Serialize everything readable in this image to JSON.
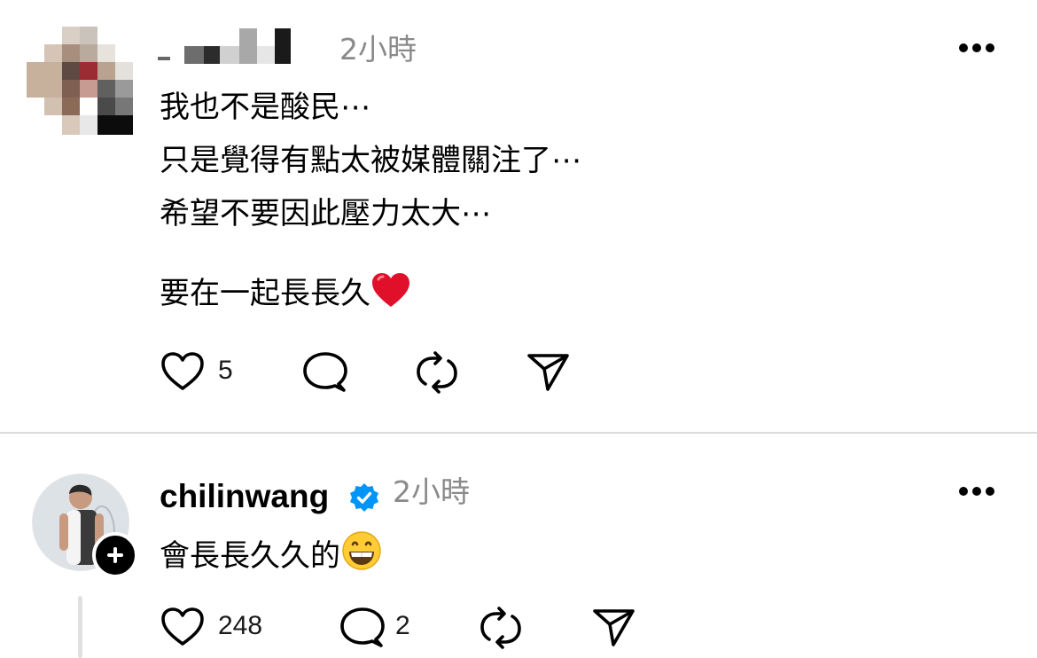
{
  "posts": [
    {
      "time": "2小時",
      "lines": [
        "我也不是酸民⋯",
        "只是覺得有點太被媒體關注了⋯",
        "希望不要因此壓力太大⋯",
        "要在一起長長久"
      ],
      "emoji": "heart-emoji",
      "likes": "5",
      "replies": "",
      "icons": [
        "heart-icon",
        "comment-icon",
        "repost-icon",
        "share-icon",
        "more-icon"
      ]
    },
    {
      "username": "chilinwang",
      "verified": true,
      "time": "2小時",
      "lines": [
        "會長長久久的"
      ],
      "emoji": "grinning-face-emoji",
      "likes": "248",
      "replies": "2",
      "icons": [
        "heart-icon",
        "comment-icon",
        "repost-icon",
        "share-icon",
        "more-icon",
        "follow-plus-icon",
        "verified-badge-icon"
      ]
    }
  ],
  "colors": {
    "text": "#000000",
    "muted": "#8a8a8a",
    "divider": "#dbdbdb",
    "verified": "#0095f6",
    "heart": "#e0102b"
  }
}
